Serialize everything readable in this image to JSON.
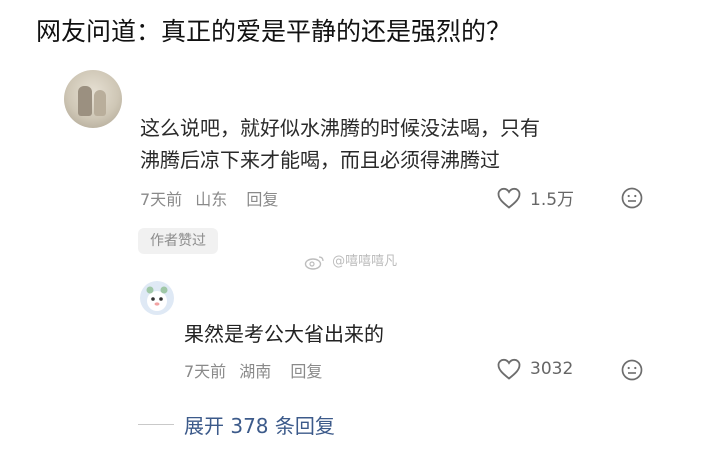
{
  "title": "网友问道：真正的爱是平静的还是强烈的？",
  "comment": {
    "text_line1": "这么说吧，就好似水沸腾的时候没法喝，只有",
    "text_line2": "沸腾后凉下来才能喝，而且必须得沸腾过",
    "time": "7天前",
    "location": "山东",
    "reply_label": "回复",
    "likes": "1.5万",
    "author_badge": "作者赞过"
  },
  "watermark": "@嘻嘻嘻凡",
  "reply": {
    "text": "果然是考公大省出来的",
    "time": "7天前",
    "location": "湖南",
    "reply_label": "回复",
    "likes": "3032"
  },
  "expand_label": "展开 378 条回复",
  "icons": [
    "heart-icon",
    "emoji-icon",
    "weibo-icon"
  ]
}
